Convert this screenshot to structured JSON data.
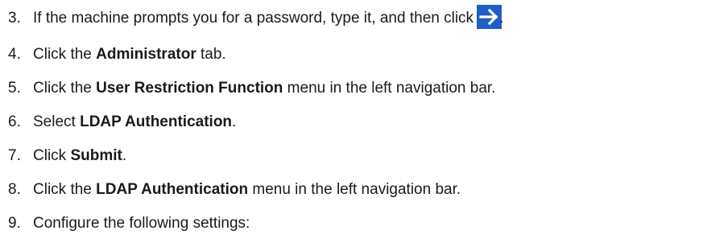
{
  "steps": [
    {
      "num": "3.",
      "before": "If the machine prompts you for a password, type it, and then click",
      "after": ".",
      "icon": "right-arrow-icon",
      "icon_color": "#1f5fc6"
    },
    {
      "num": "4.",
      "before": "Click the ",
      "bold": "Administrator",
      "after": " tab."
    },
    {
      "num": "5.",
      "before": "Click the ",
      "bold": "User Restriction Function",
      "after": " menu in the left navigation bar."
    },
    {
      "num": "6.",
      "before": "Select ",
      "bold": "LDAP Authentication",
      "after": "."
    },
    {
      "num": "7.",
      "before": "Click ",
      "bold": "Submit",
      "after": "."
    },
    {
      "num": "8.",
      "before": "Click the ",
      "bold": "LDAP Authentication",
      "after": " menu in the left navigation bar."
    },
    {
      "num": "9.",
      "before": "Configure the following settings:"
    }
  ]
}
